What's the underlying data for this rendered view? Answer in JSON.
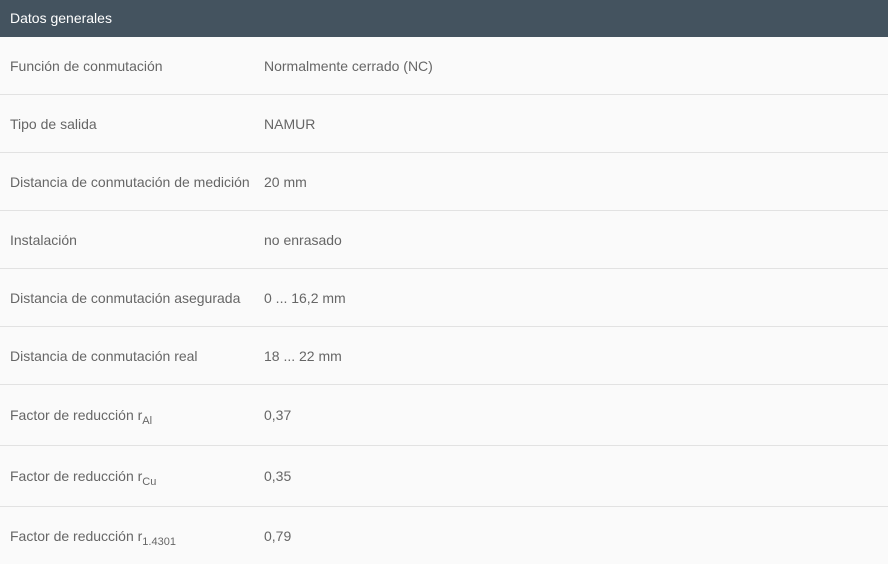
{
  "header": {
    "title": "Datos generales"
  },
  "rows": [
    {
      "label": "Función de conmutación",
      "value": "Normalmente cerrado (NC)"
    },
    {
      "label": "Tipo de salida",
      "value": "NAMUR"
    },
    {
      "label": "Distancia de conmutación de medición",
      "value": "20 mm"
    },
    {
      "label": "Instalación",
      "value": "no enrasado"
    },
    {
      "label": "Distancia de conmutación asegurada",
      "value": "0 ... 16,2 mm"
    },
    {
      "label": "Distancia de conmutación real",
      "value": "18 ... 22 mm"
    },
    {
      "label": "Factor de reducción r",
      "sub": "Al",
      "value": "0,37"
    },
    {
      "label": "Factor de reducción r",
      "sub": "Cu",
      "value": "0,35"
    },
    {
      "label": "Factor de reducción r",
      "sub": "1.4301",
      "value": "0,79"
    }
  ],
  "colors": {
    "header_bg": "#44535f",
    "header_text": "#ffffff",
    "row_bg": "#fafafa",
    "row_text": "#666666",
    "divider": "#e2e2e2"
  }
}
